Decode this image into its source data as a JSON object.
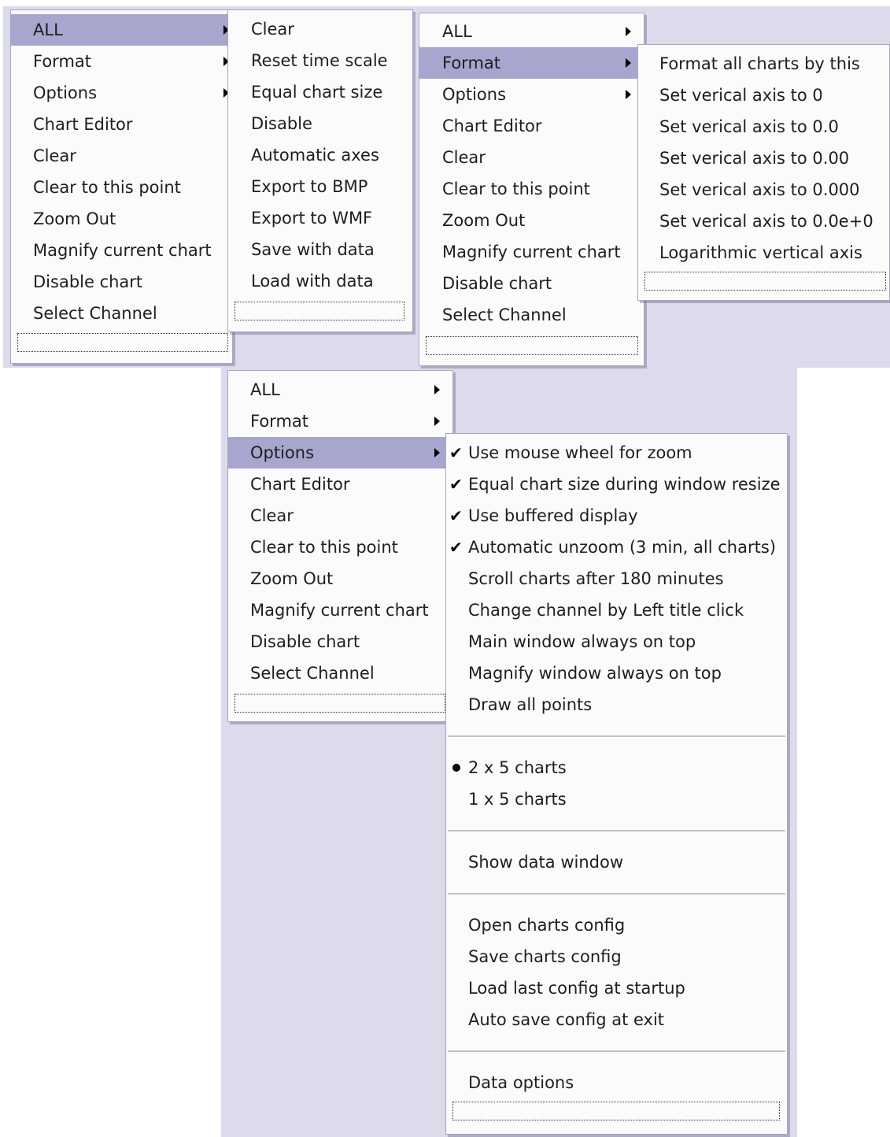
{
  "menu_a": {
    "items": [
      {
        "label": "ALL",
        "arrow": true,
        "highlighted": true
      },
      {
        "label": "Format",
        "arrow": true
      },
      {
        "label": "Options",
        "arrow": true
      },
      {
        "label": "Chart Editor"
      },
      {
        "label": "Clear"
      },
      {
        "label": "Clear to this point"
      },
      {
        "label": "Zoom Out"
      },
      {
        "label": "Magnify current chart"
      },
      {
        "label": "Disable chart"
      },
      {
        "label": "Select Channel"
      }
    ]
  },
  "submenu_all": {
    "items": [
      {
        "label": "Clear"
      },
      {
        "label": "Reset time scale"
      },
      {
        "label": "Equal chart size"
      },
      {
        "label": "Disable"
      },
      {
        "label": "Automatic axes"
      },
      {
        "label": "Export to BMP"
      },
      {
        "label": "Export to WMF"
      },
      {
        "label": "Save with data"
      },
      {
        "label": "Load with data"
      }
    ]
  },
  "menu_b": {
    "items": [
      {
        "label": "ALL",
        "arrow": true
      },
      {
        "label": "Format",
        "arrow": true,
        "highlighted": true
      },
      {
        "label": "Options",
        "arrow": true
      },
      {
        "label": "Chart Editor"
      },
      {
        "label": "Clear"
      },
      {
        "label": "Clear to this point"
      },
      {
        "label": "Zoom Out"
      },
      {
        "label": "Magnify current chart"
      },
      {
        "label": "Disable chart"
      },
      {
        "label": "Select Channel"
      }
    ]
  },
  "submenu_format": {
    "items": [
      {
        "label": "Format all charts by this"
      },
      {
        "label": "Set verical axis to 0"
      },
      {
        "label": "Set verical axis to 0.0"
      },
      {
        "label": "Set verical axis to 0.00"
      },
      {
        "label": "Set verical axis to 0.000"
      },
      {
        "label": "Set verical axis to 0.0e+0"
      },
      {
        "label": "Logarithmic vertical axis"
      }
    ]
  },
  "menu_c": {
    "items": [
      {
        "label": "ALL",
        "arrow": true
      },
      {
        "label": "Format",
        "arrow": true
      },
      {
        "label": "Options",
        "arrow": true,
        "highlighted": true
      },
      {
        "label": "Chart Editor"
      },
      {
        "label": "Clear"
      },
      {
        "label": "Clear to this point"
      },
      {
        "label": "Zoom Out"
      },
      {
        "label": "Magnify current chart"
      },
      {
        "label": "Disable chart"
      },
      {
        "label": "Select Channel"
      }
    ]
  },
  "submenu_options": {
    "items": [
      {
        "label": "Use mouse wheel for zoom",
        "checked": true
      },
      {
        "label": "Equal chart size during window resize",
        "checked": true
      },
      {
        "label": "Use buffered display",
        "checked": true
      },
      {
        "label": "Automatic unzoom (3 min, all charts)",
        "checked": true
      },
      {
        "label": "Scroll charts after 180 minutes"
      },
      {
        "label": "Change channel by Left title click"
      },
      {
        "label": "Main window always on top"
      },
      {
        "label": "Magnify window always on top"
      },
      {
        "label": "Draw all points"
      },
      {
        "separator": true
      },
      {
        "label": "2 x 5 charts",
        "radio": true
      },
      {
        "label": "1 x 5 charts"
      },
      {
        "separator": true
      },
      {
        "label": "Show data window"
      },
      {
        "separator": true
      },
      {
        "label": "Open charts config"
      },
      {
        "label": "Save charts config"
      },
      {
        "label": "Load last config at startup"
      },
      {
        "label": "Auto save config at exit"
      },
      {
        "separator": true
      },
      {
        "label": "Data options"
      }
    ]
  },
  "colors": {
    "menu_bg": "#fbfbfb",
    "highlight": "#a7a6cf",
    "backdrop": "#dcdbec",
    "separator": "#c2c2c8"
  },
  "icons": {
    "submenu": "submenu-arrow-icon",
    "check": "check-icon",
    "radio": "radio-bullet-icon"
  }
}
